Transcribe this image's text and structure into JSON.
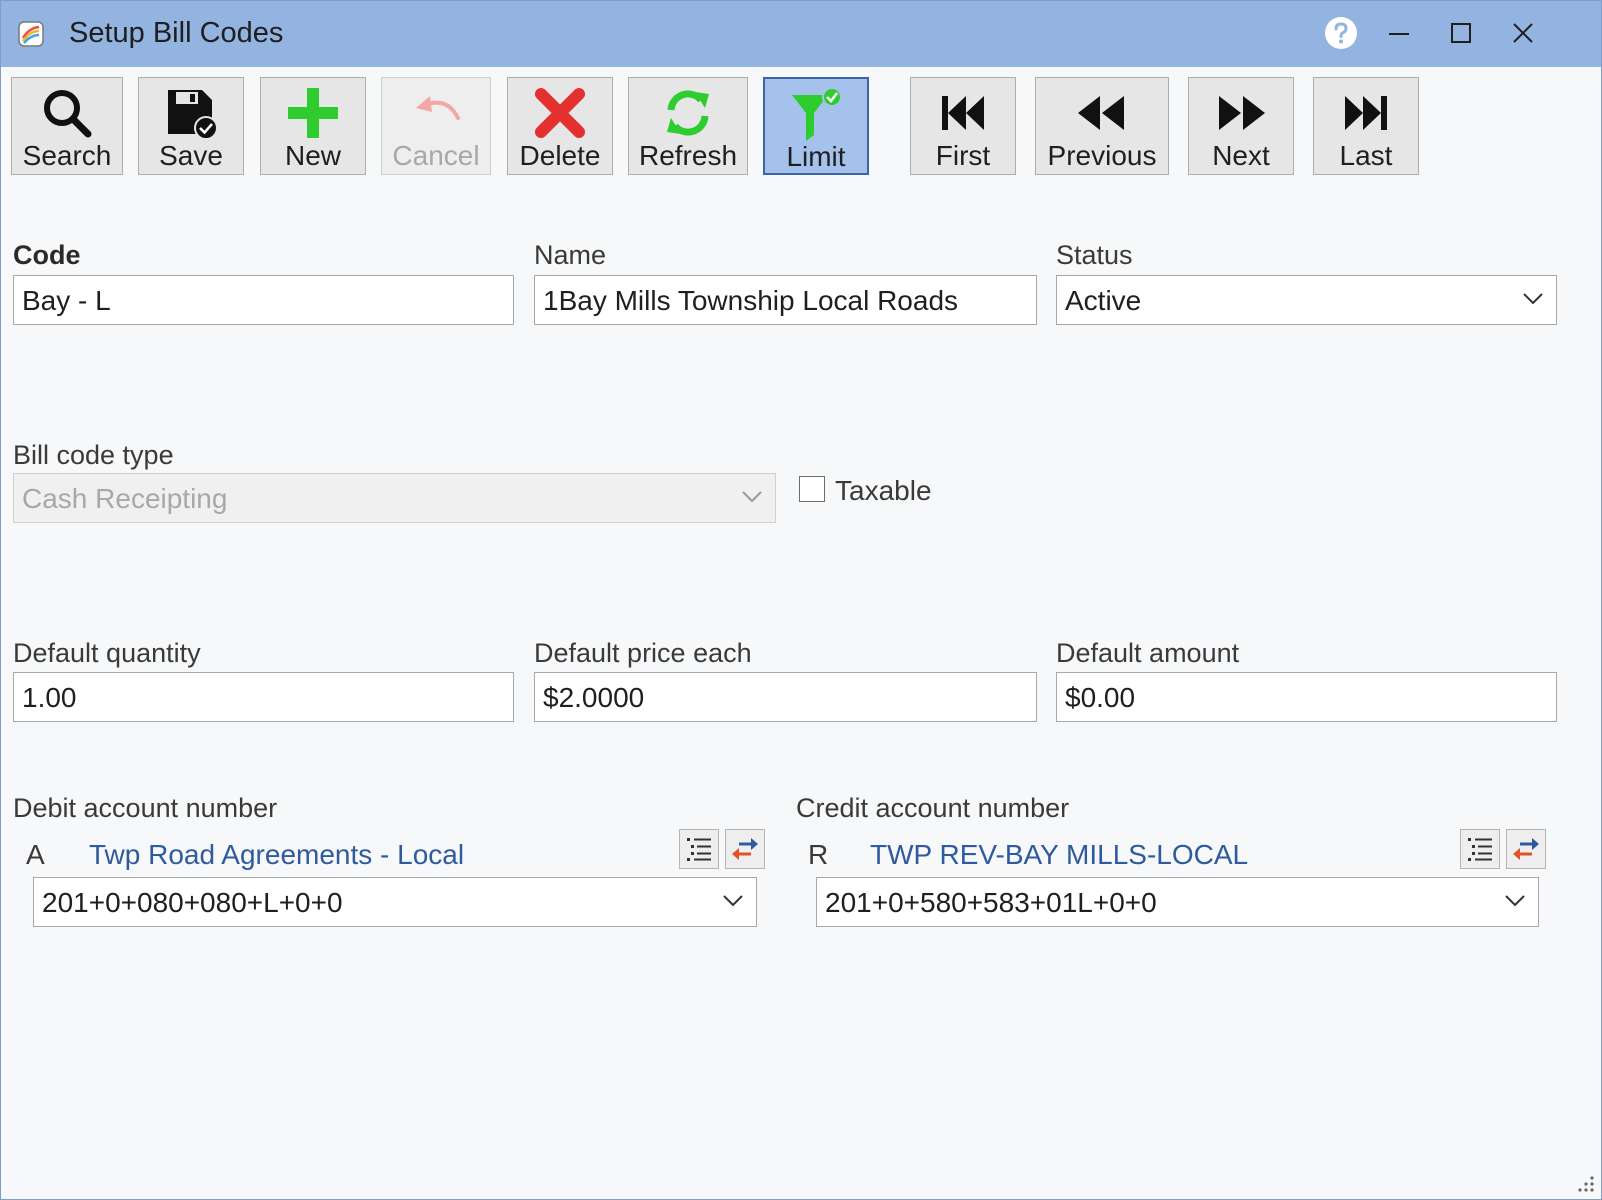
{
  "window": {
    "title": "Setup Bill Codes"
  },
  "toolbar": {
    "search_label": "Search",
    "save_label": "Save",
    "new_label": "New",
    "cancel_label": "Cancel",
    "delete_label": "Delete",
    "refresh_label": "Refresh",
    "limit_label": "Limit",
    "first_label": "First",
    "previous_label": "Previous",
    "next_label": "Next",
    "last_label": "Last"
  },
  "form": {
    "code": {
      "label": "Code",
      "value": "Bay - L"
    },
    "name": {
      "label": "Name",
      "value": "1Bay Mills Township Local Roads"
    },
    "status": {
      "label": "Status",
      "value": "Active"
    },
    "bill_code_type": {
      "label": "Bill code type",
      "value": "Cash Receipting"
    },
    "taxable": {
      "label": "Taxable",
      "checked": false
    },
    "default_quantity": {
      "label": "Default quantity",
      "value": "1.00"
    },
    "default_price_each": {
      "label": "Default price each",
      "value": "$2.0000"
    },
    "default_amount": {
      "label": "Default amount",
      "value": "$0.00"
    },
    "debit_account": {
      "label": "Debit account number",
      "prefix": "A",
      "description": "Twp Road Agreements - Local",
      "value": "201+0+080+080+L+0+0"
    },
    "credit_account": {
      "label": "Credit account number",
      "prefix": "R",
      "description": "TWP REV-BAY MILLS-LOCAL",
      "value": "201+0+580+583+01L+0+0"
    }
  },
  "colors": {
    "titlebar": "#93b3e0",
    "active_button": "#a4c2ec",
    "link_text": "#2f5a9e",
    "new_icon": "#2ecc2e",
    "delete_icon": "#e53030",
    "refresh_icon": "#2ecc2e",
    "limit_icon": "#2ecc2e"
  }
}
